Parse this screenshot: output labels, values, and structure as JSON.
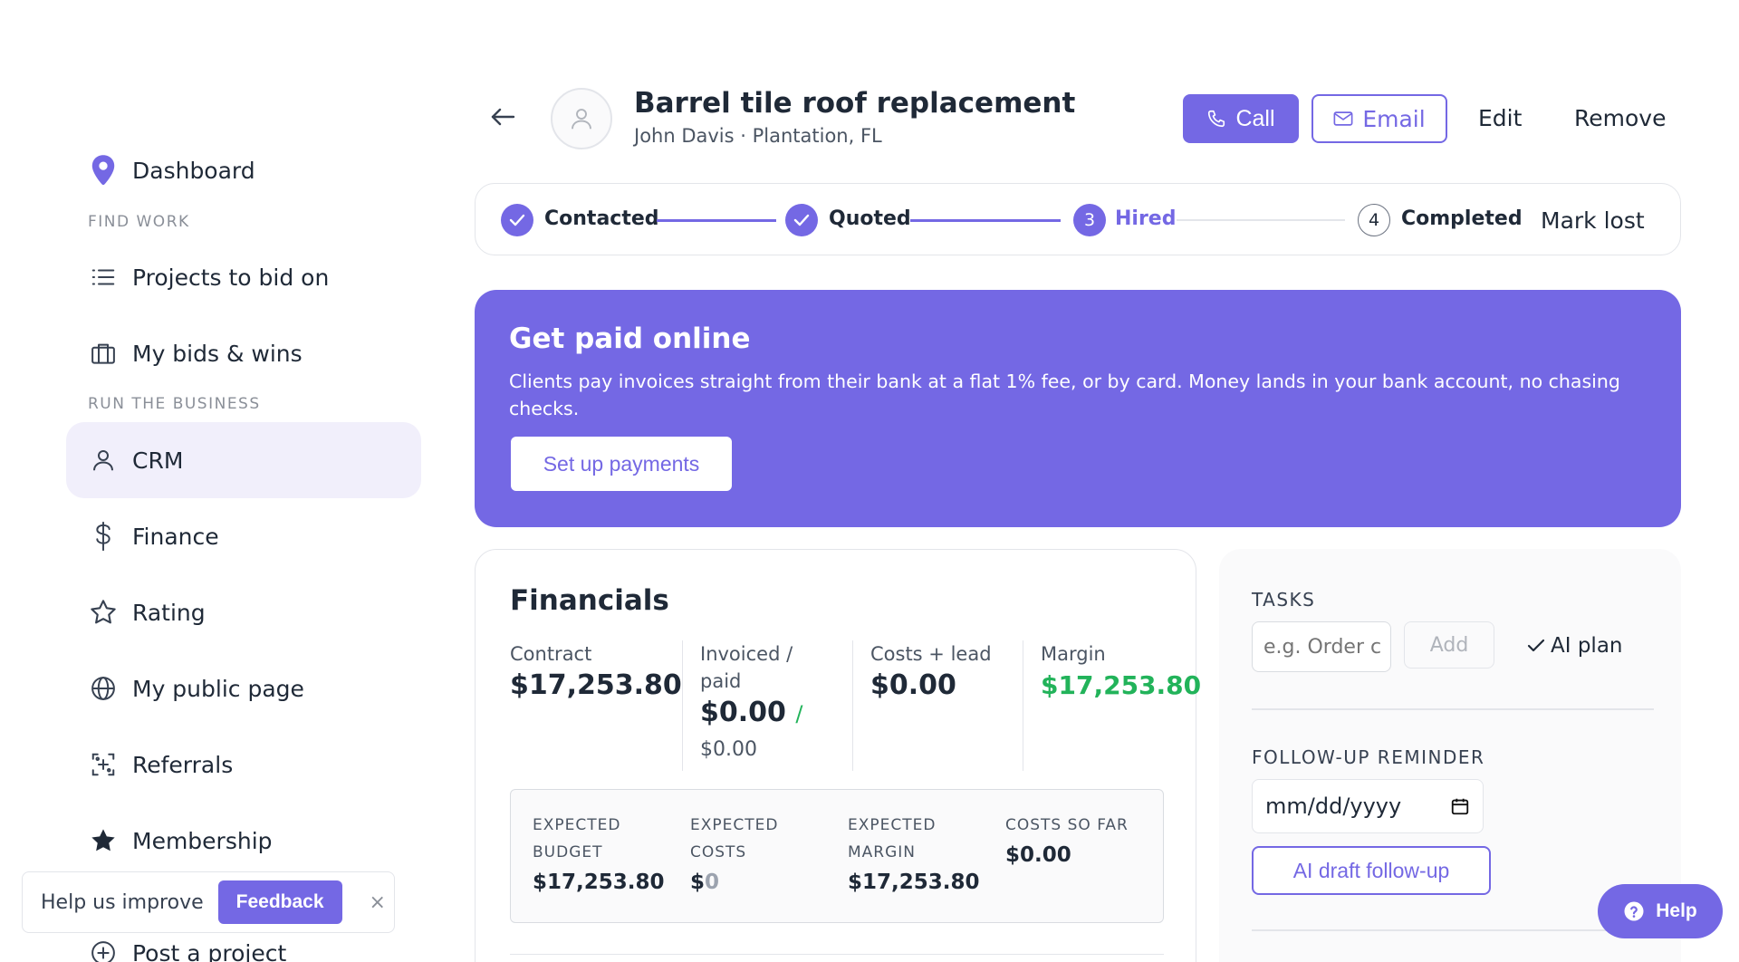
{
  "sidebar": {
    "dashboard": "Dashboard",
    "section_find_work": "FIND WORK",
    "projects_to_bid": "Projects to bid on",
    "my_bids": "My bids & wins",
    "section_run_business": "RUN THE BUSINESS",
    "crm": "CRM",
    "finance": "Finance",
    "rating": "Rating",
    "public_page": "My public page",
    "referrals": "Referrals",
    "membership": "Membership",
    "post_project": "Post a project"
  },
  "feedback": {
    "text": "Help us improve",
    "button": "Feedback",
    "close": "×"
  },
  "header": {
    "title": "Barrel tile roof replacement",
    "subtitle": "John Davis · Plantation, FL",
    "call": "Call",
    "email": "Email",
    "edit": "Edit",
    "remove": "Remove"
  },
  "stepper": {
    "steps": [
      {
        "label": "Contacted",
        "state": "done"
      },
      {
        "label": "Quoted",
        "state": "done"
      },
      {
        "label": "Hired",
        "number": "3",
        "state": "current"
      },
      {
        "label": "Completed",
        "number": "4",
        "state": "todo"
      }
    ],
    "mark_lost": "Mark lost"
  },
  "promo": {
    "title": "Get paid online",
    "text": "Clients pay invoices straight from their bank at a flat 1% fee, or by card. Money lands in your bank account, no chasing checks.",
    "button": "Set up payments"
  },
  "financials": {
    "title": "Financials",
    "contract_label": "Contract",
    "contract_value": "$17,253.80",
    "invoiced_label_1": "Invoiced /",
    "invoiced_label_2": "paid",
    "invoiced_value": "$0.00",
    "invoiced_sep": "/",
    "paid_value": "$0.00",
    "costs_label": "Costs + lead",
    "costs_value": "$0.00",
    "margin_label": "Margin",
    "margin_value": "$17,253.80",
    "expected": {
      "budget_label_1": "EXPECTED",
      "budget_label_2": "BUDGET",
      "budget_value": "$17,253.80",
      "costs_label_1": "EXPECTED",
      "costs_label_2": "COSTS",
      "costs_value_prefix": "$",
      "costs_value_num": "0",
      "margin_label_1": "EXPECTED",
      "margin_label_2": "MARGIN",
      "margin_value": "$17,253.80",
      "so_far_label": "COSTS SO FAR",
      "so_far_value": "$0.00"
    }
  },
  "tasks": {
    "label": "TASKS",
    "placeholder": "e.g. Order c",
    "add": "Add",
    "ai_plan": "AI plan",
    "followup_label": "FOLLOW-UP REMINDER",
    "date_value": "mm/dd/yyyy",
    "ai_draft": "AI draft follow-up"
  },
  "help": {
    "label": "Help"
  },
  "colors": {
    "accent": "#7468e4",
    "green": "#22b35a"
  }
}
